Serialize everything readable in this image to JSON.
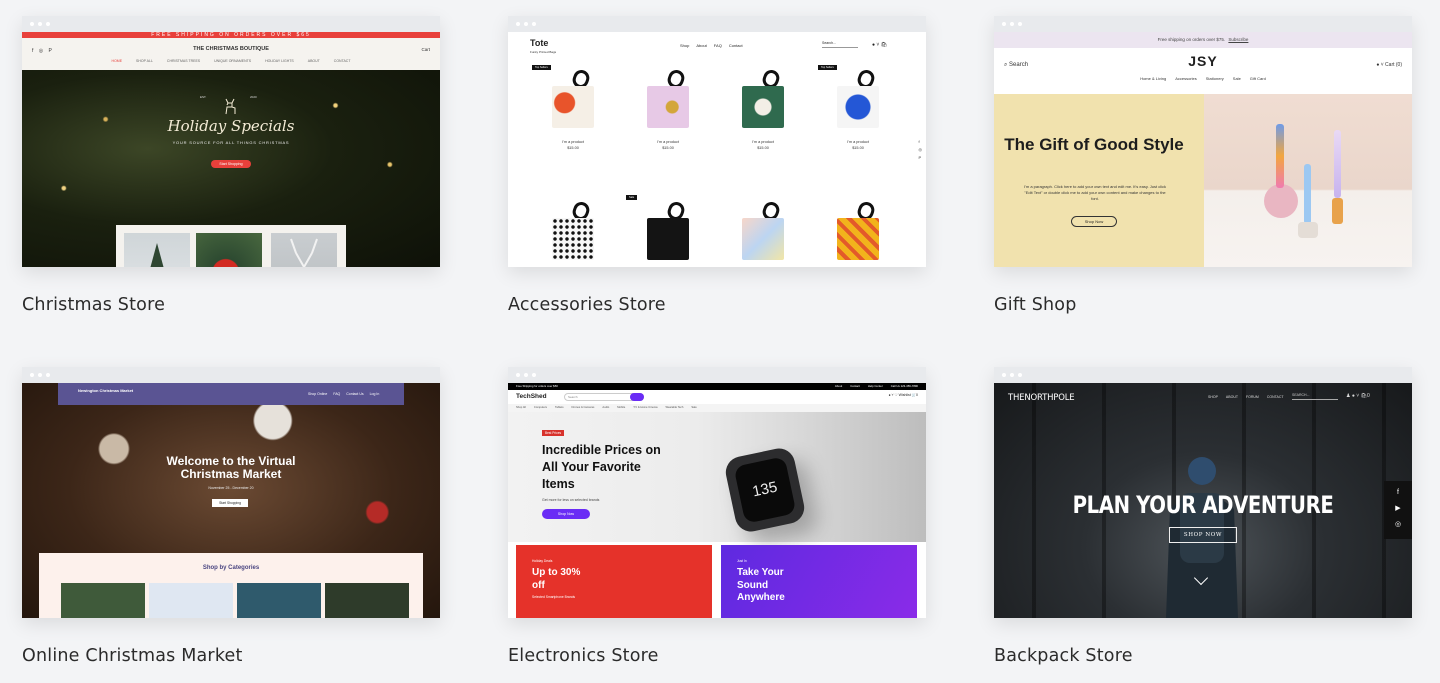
{
  "templates": [
    {
      "title": "Christmas Store",
      "preview": {
        "promo": "FREE SHIPPING ON ORDERS OVER $65",
        "brand": "THE CHRISTMAS BOUTIQUE",
        "social": "f ◎ P",
        "cart": "Cart",
        "nav": [
          "HOME",
          "SHOP ALL",
          "CHRISTMAS TREES",
          "UNIQUE ORNAMENTS",
          "HOLIDAY LIGHTS",
          "ABOUT",
          "CONTACT"
        ],
        "est": "EST.",
        "year": "2020",
        "hero_title": "Holiday Specials",
        "hero_sub": "YOUR SOURCE FOR ALL THINGS CHRISTMAS",
        "cta": "Start Shopping"
      }
    },
    {
      "title": "Accessories Store",
      "preview": {
        "logo": "Tote",
        "logo_sub": "Funky Printed Bags",
        "nav": [
          "Shop",
          "About",
          "FAQ",
          "Contact"
        ],
        "search": "Search...",
        "icons": "● ˅ 🛍",
        "tags": [
          "Top Sellers",
          "Top Sellers",
          "Sale"
        ],
        "product_name": "I'm a product",
        "product_price": "$15.00",
        "side": "f\n◎\nP"
      }
    },
    {
      "title": "Gift Shop",
      "preview": {
        "promo": "Free shipping on orders over $75.",
        "promo_link": "Subscribe",
        "search": "Search",
        "logo": "JSY",
        "nav": [
          "Home & Living",
          "Accessories",
          "Stationery",
          "Sale",
          "Gift Card"
        ],
        "cart": "● ˅   Cart (0)",
        "headline": "The Gift of Good Style",
        "paragraph": "I'm a paragraph. Click here to add your own text and edit me. It's easy. Just click \"Edit Text\" or double click me to add your own content and make changes to the font.",
        "cta": "Shop Now"
      }
    },
    {
      "title": "Online Christmas Market",
      "preview": {
        "brand": "Newington Christmas Market",
        "nav": [
          "Shop Online",
          "FAQ",
          "Contact Us",
          "Log In"
        ],
        "hero_title": "Welcome to the Virtual Christmas Market",
        "date": "November 25 - December 20",
        "cta": "Start Shopping",
        "section": "Shop by Categories"
      }
    },
    {
      "title": "Electronics Store",
      "preview": {
        "top_left": "Free Shipping for orders over $50",
        "top_links": [
          "About",
          "Contact",
          "Help Center",
          "Call Us 123-456-7890"
        ],
        "logo": "TechShed",
        "search": "Search",
        "icons": "● ˅  ♡ Wishlist  🛒0",
        "categories": [
          "Shop All",
          "Computers",
          "Tablets",
          "Drones & Cameras",
          "Audio",
          "Mobile",
          "T.V & Home Cinema",
          "Wearable Tech",
          "Sale"
        ],
        "badge": "Best Prices",
        "headline": "Incredible Prices on All Your Favorite Items",
        "sub": "Get more for less on selected brands",
        "cta": "Shop Now",
        "watch_number": "135",
        "promo1_small": "Holiday Deals",
        "promo1": "Up to 30% off",
        "promo1_sub": "Selected Smartphone Brands",
        "promo2_small": "Just In",
        "promo2": "Take Your Sound Anywhere"
      }
    },
    {
      "title": "Backpack Store",
      "preview": {
        "logo": "THENORTHPOLE",
        "nav": [
          "SHOP",
          "ABOUT",
          "FORUM",
          "CONTACT"
        ],
        "search": "SEARCH...",
        "icons": "♟ ● ˅ 🛍0",
        "headline": "PLAN YOUR ADVENTURE",
        "cta": "SHOP NOW",
        "side": [
          "f",
          "▶",
          "◎"
        ]
      }
    }
  ]
}
